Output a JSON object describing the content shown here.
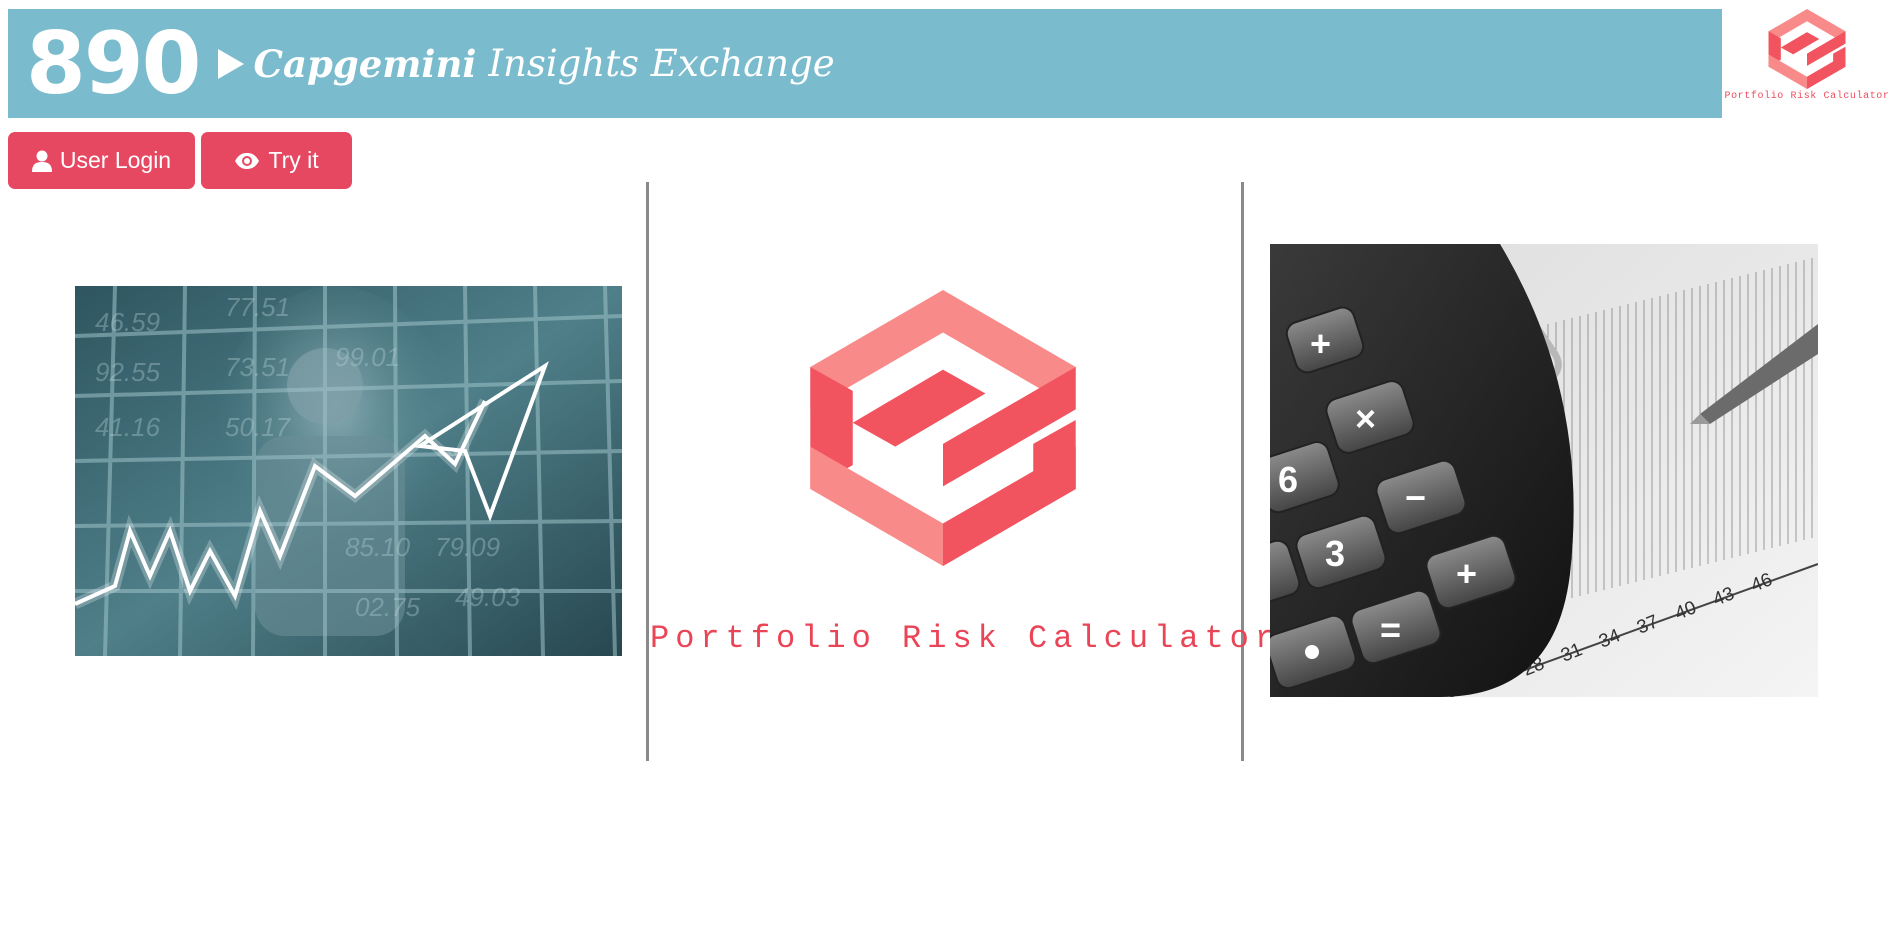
{
  "header": {
    "number": "890",
    "brand": "Capgemini",
    "subtitle": "Insights Exchange"
  },
  "corner_logo": {
    "caption": "Portfolio Risk Calculator",
    "icon": "portfolio-risk-logo-icon"
  },
  "actions": {
    "login_label": "User Login",
    "login_icon": "user-icon",
    "try_label": "Try it",
    "try_icon": "eye-icon"
  },
  "center": {
    "title": "Portfolio Risk Calculator"
  },
  "images": {
    "left": "stock-chart-photo",
    "right": "calculator-photo"
  },
  "colors": {
    "banner": "#7abccd",
    "button": "#e64862",
    "logo_dark": "#f2545f",
    "logo_light": "#f98a8a"
  }
}
